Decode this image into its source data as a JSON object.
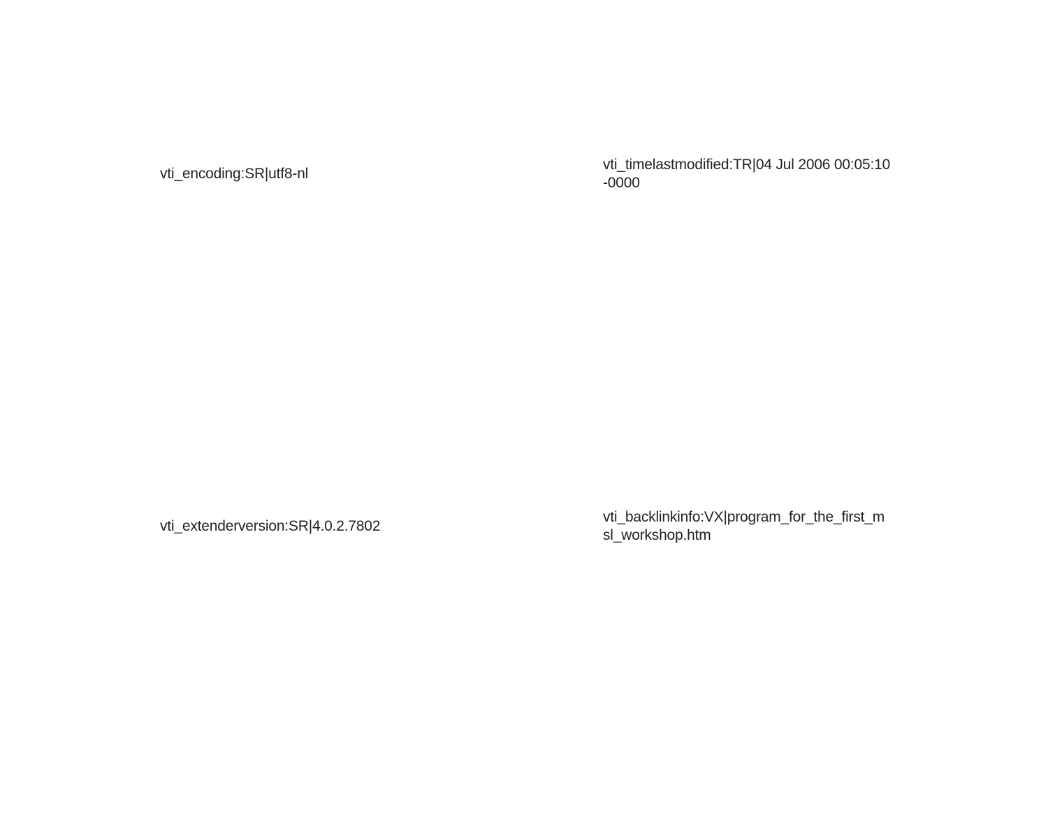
{
  "entries": [
    {
      "text": "vti_encoding:SR|utf8-nl"
    },
    {
      "text": "vti_timelastmodified:TR|04 Jul 2006 00:05:10\n-0000"
    },
    {
      "text": "vti_extenderversion:SR|4.0.2.7802"
    },
    {
      "text": "vti_backlinkinfo:VX|program_for_the_first_m\nsl_workshop.htm"
    }
  ]
}
